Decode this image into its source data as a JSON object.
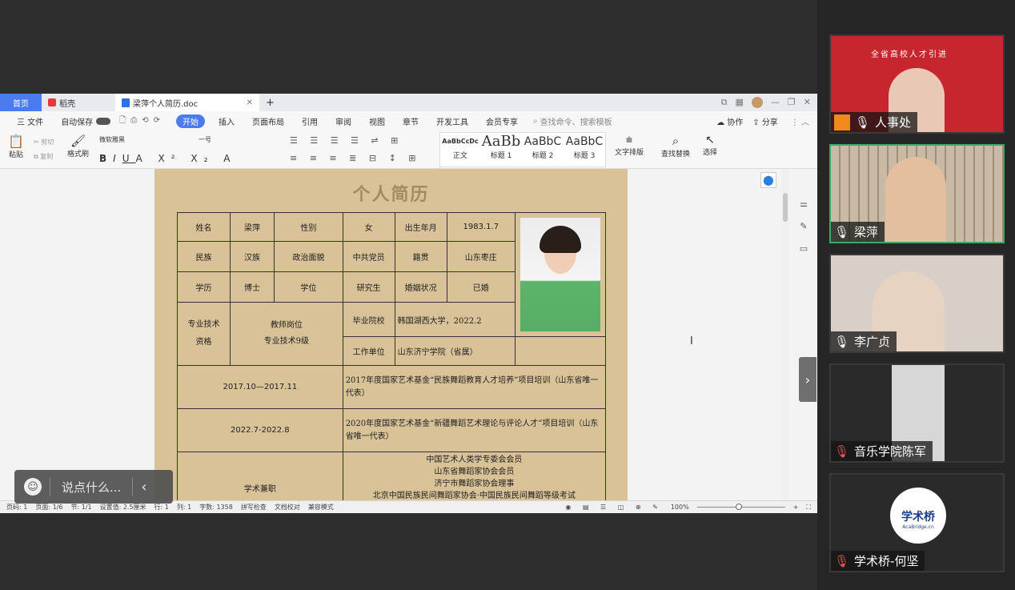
{
  "wps": {
    "tabs": [
      {
        "label": "首页"
      },
      {
        "label": "稻壳"
      },
      {
        "label": "梁萍个人简历.doc"
      }
    ],
    "new_tab": "+",
    "menu": [
      "三 文件",
      "自动保存",
      "开始",
      "插入",
      "页面布局",
      "引用",
      "审阅",
      "视图",
      "章节",
      "开发工具",
      "会员专享"
    ],
    "search_placeholder": "查找命令、搜索模板",
    "collab": "协作",
    "share": "分享",
    "ribbon": {
      "paste": "粘贴",
      "cut": "剪切",
      "copy": "复制",
      "format_painter": "格式刷",
      "font_name": "微软雅黑",
      "font_size": "一号",
      "styles": [
        {
          "preview": "AaBbCcDc",
          "name": "正文"
        },
        {
          "preview": "AaBb",
          "name": "标题 1"
        },
        {
          "preview": "AaBbC",
          "name": "标题 2"
        },
        {
          "preview": "AaBbC",
          "name": "标题 3"
        }
      ],
      "text_layout": "文字排版",
      "find_replace": "查找替换",
      "select": "选择"
    },
    "status": [
      "页码: 1",
      "页面: 1/6",
      "节: 1/1",
      "设置值: 2.5厘米",
      "行: 1",
      "列: 1",
      "字数: 1358",
      "拼写检查",
      "文档校对",
      "兼容模式"
    ],
    "zoom": "100%"
  },
  "resume": {
    "title": "个人简历",
    "row1": [
      "姓名",
      "梁萍",
      "性别",
      "女",
      "出生年月",
      "1983.1.7"
    ],
    "row2": [
      "民族",
      "汉族",
      "政治面貌",
      "中共党员",
      "籍贯",
      "山东枣庄"
    ],
    "row3": [
      "学历",
      "博士",
      "学位",
      "研究生",
      "婚姻状况",
      "已婚"
    ],
    "row4": {
      "label": "专业技术\n资格",
      "value_line1": "教师岗位",
      "value_line2": "专业技术9级",
      "grad_label": "毕业院校",
      "grad_value": "韩国湖西大学，2022.2",
      "work_label": "工作单位",
      "work_value": "山东济宁学院（省属）"
    },
    "training": [
      {
        "period": "2017.10—2017.11",
        "desc": "2017年度国家艺术基金“民族舞蹈教育人才培养”项目培训（山东省唯一代表）"
      },
      {
        "period": "2022.7-2022.8",
        "desc": "2020年度国家艺术基金“新疆舞蹈艺术理论与评论人才”项目培训（山东省唯一代表）"
      }
    ],
    "academic": {
      "label": "学术兼职",
      "lines": [
        "中国艺术人类学专委会会员",
        "山东省舞蹈家协会会员",
        "济宁市舞蹈家协会理事",
        "北京中国民族民间舞蹈家协会·中国民族民间舞蹈等级考试"
      ]
    }
  },
  "chat": {
    "placeholder": "说点什么..."
  },
  "participants": [
    {
      "name": "人事处",
      "banner": "全省高校人才引进"
    },
    {
      "name": "梁萍"
    },
    {
      "name": "李广贞"
    },
    {
      "name": "音乐学院陈军"
    },
    {
      "name": "学术桥-何坚",
      "logo_text": "学术桥",
      "logo_sub": "AcaBridge.cn"
    }
  ],
  "colors": {
    "accent": "#4a7cf0",
    "paper": "#d9c298",
    "active_border": "#3fa869",
    "red_banner": "#c8262e"
  }
}
